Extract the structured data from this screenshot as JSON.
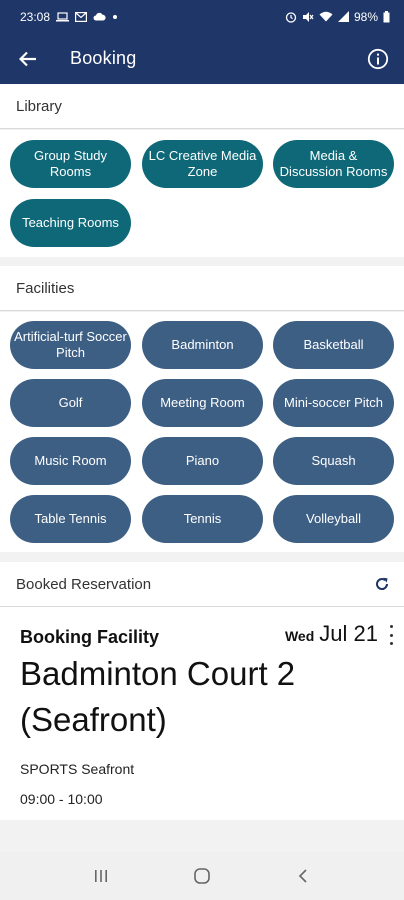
{
  "status_bar": {
    "time": "23:08",
    "battery": "98%",
    "left_icons": [
      "laptop-icon",
      "mail-icon",
      "cloud-icon",
      "dot-icon"
    ],
    "right_icons": [
      "alarm-icon",
      "mute-icon",
      "wifi-icon",
      "signal-icon"
    ]
  },
  "app_bar": {
    "title": "Booking",
    "back_icon": "back-arrow-icon",
    "info_icon": "info-icon"
  },
  "library": {
    "heading": "Library",
    "items": [
      "Group Study Rooms",
      "LC Creative Media Zone",
      "Media & Discussion Rooms",
      "Teaching Rooms"
    ],
    "chip_color": "#0e6878"
  },
  "facilities": {
    "heading": "Facilities",
    "items": [
      "Artificial-turf Soccer Pitch",
      "Badminton",
      "Basketball",
      "Golf",
      "Meeting Room",
      "Mini-soccer Pitch",
      "Music Room",
      "Piano",
      "Squash",
      "Table Tennis",
      "Tennis",
      "Volleyball"
    ],
    "chip_color": "#3d5f84"
  },
  "booked": {
    "heading": "Booked Reservation",
    "refresh_icon": "refresh-icon",
    "card": {
      "label": "Booking Facility",
      "day_of_week": "Wed",
      "date": "Jul 21",
      "facility": "Badminton Court 2 (Seafront)",
      "location": "SPORTS Seafront",
      "time": "09:00 - 10:00",
      "menu_icon": "more-vert-icon"
    }
  },
  "nav_bar": {
    "icons": [
      "recents-icon",
      "home-icon",
      "back-icon"
    ]
  },
  "colors": {
    "primary": "#1f3668",
    "teal_chip": "#0e6878",
    "slate_chip": "#3d5f84",
    "refresh": "#1f3668"
  }
}
